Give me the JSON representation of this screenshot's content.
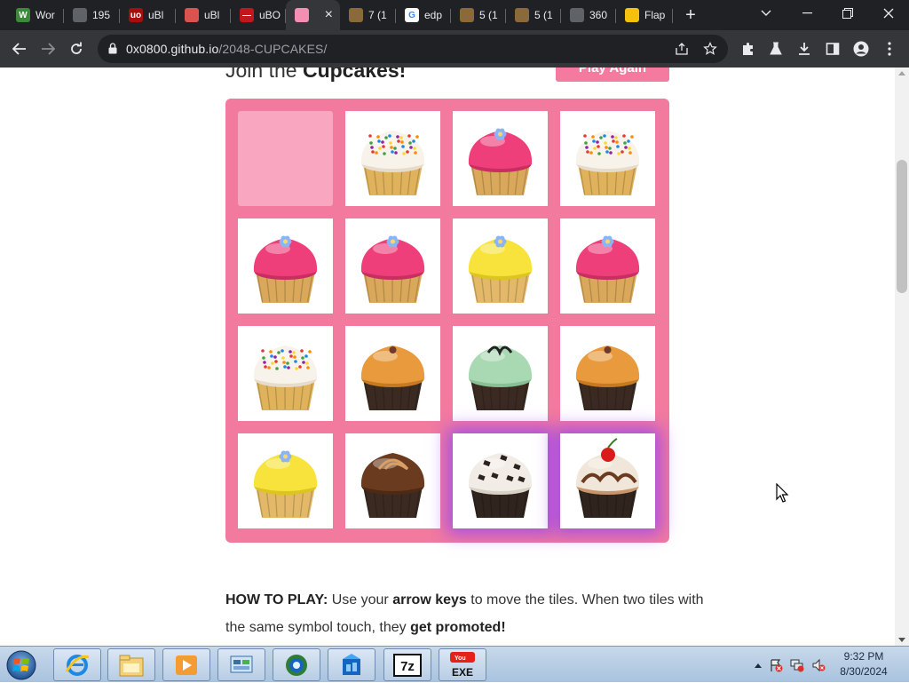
{
  "browser": {
    "tabs": [
      {
        "title": "Wor",
        "favicon": "w-icon",
        "color": "#3a8a3a",
        "glyph": "W"
      },
      {
        "title": "195",
        "favicon": "globe-icon",
        "color": "#5f6368",
        "glyph": ""
      },
      {
        "title": "uBl",
        "favicon": "ublock-icon",
        "color": "#a80d0d",
        "glyph": "uo"
      },
      {
        "title": "uBl",
        "favicon": "image-icon",
        "color": "#d9534f",
        "glyph": ""
      },
      {
        "title": "uBO",
        "favicon": "stop-icon",
        "color": "#c0161e",
        "glyph": "—"
      },
      {
        "title": "",
        "favicon": "cupcakes-icon",
        "color": "#f48fb1",
        "glyph": ""
      },
      {
        "title": "7 (1",
        "favicon": "folder-icon",
        "color": "#8a6a3a",
        "glyph": ""
      },
      {
        "title": "edp",
        "favicon": "google-icon",
        "color": "#ffffff",
        "glyph": "G"
      },
      {
        "title": "5 (1",
        "favicon": "folder-icon",
        "color": "#8a6a3a",
        "glyph": ""
      },
      {
        "title": "5 (1",
        "favicon": "folder-icon",
        "color": "#8a6a3a",
        "glyph": ""
      },
      {
        "title": "360",
        "favicon": "globe-icon",
        "color": "#5f6368",
        "glyph": ""
      },
      {
        "title": "Flap",
        "favicon": "flappy-icon",
        "color": "#f4c20d",
        "glyph": ""
      }
    ],
    "active_tab_index": 5,
    "url_host": "0x0800.github.io",
    "url_path": "/2048-CUPCAKES/"
  },
  "page": {
    "heading_prefix": "Join the ",
    "heading_bold": "Cupcakes!",
    "play_again_label": "Play Again",
    "howto": {
      "label": "HOW TO PLAY:",
      "t1": " Use your ",
      "b1": "arrow keys",
      "t2": " to move the tiles. When two tiles with the same symbol touch, they ",
      "b2": "get promoted!"
    }
  },
  "board": {
    "size": 4,
    "tiles": [
      [
        "empty",
        "sprinkle-cupcake",
        "pink-cupcake",
        "sprinkle-cupcake"
      ],
      [
        "pink-cupcake",
        "pink-cupcake",
        "yellow-cupcake",
        "pink-cupcake"
      ],
      [
        "sprinkle-cupcake",
        "caramel-cupcake",
        "mint-cupcake",
        "caramel-cupcake"
      ],
      [
        "yellow-cupcake",
        "chocolate-swirl-cupcake",
        "cookies-cream-cupcake",
        "cherry-sundae-cupcake"
      ]
    ],
    "glowing": [
      "3-2",
      "3-3"
    ]
  },
  "taskbar": {
    "apps": [
      "internet-explorer-icon",
      "file-explorer-icon",
      "media-player-icon",
      "control-panel-icon",
      "browser-globe-icon",
      "gallery-icon",
      "7zip-icon",
      "youtube-exe-icon"
    ],
    "seven_zip_label": "7z",
    "exe_label": "EXE",
    "clock_time": "9:32 PM",
    "clock_date": "8/30/2024"
  },
  "colors": {
    "board": "#f27a9f",
    "empty_cell": "#f9a6c1",
    "glow": "#9646f0"
  }
}
